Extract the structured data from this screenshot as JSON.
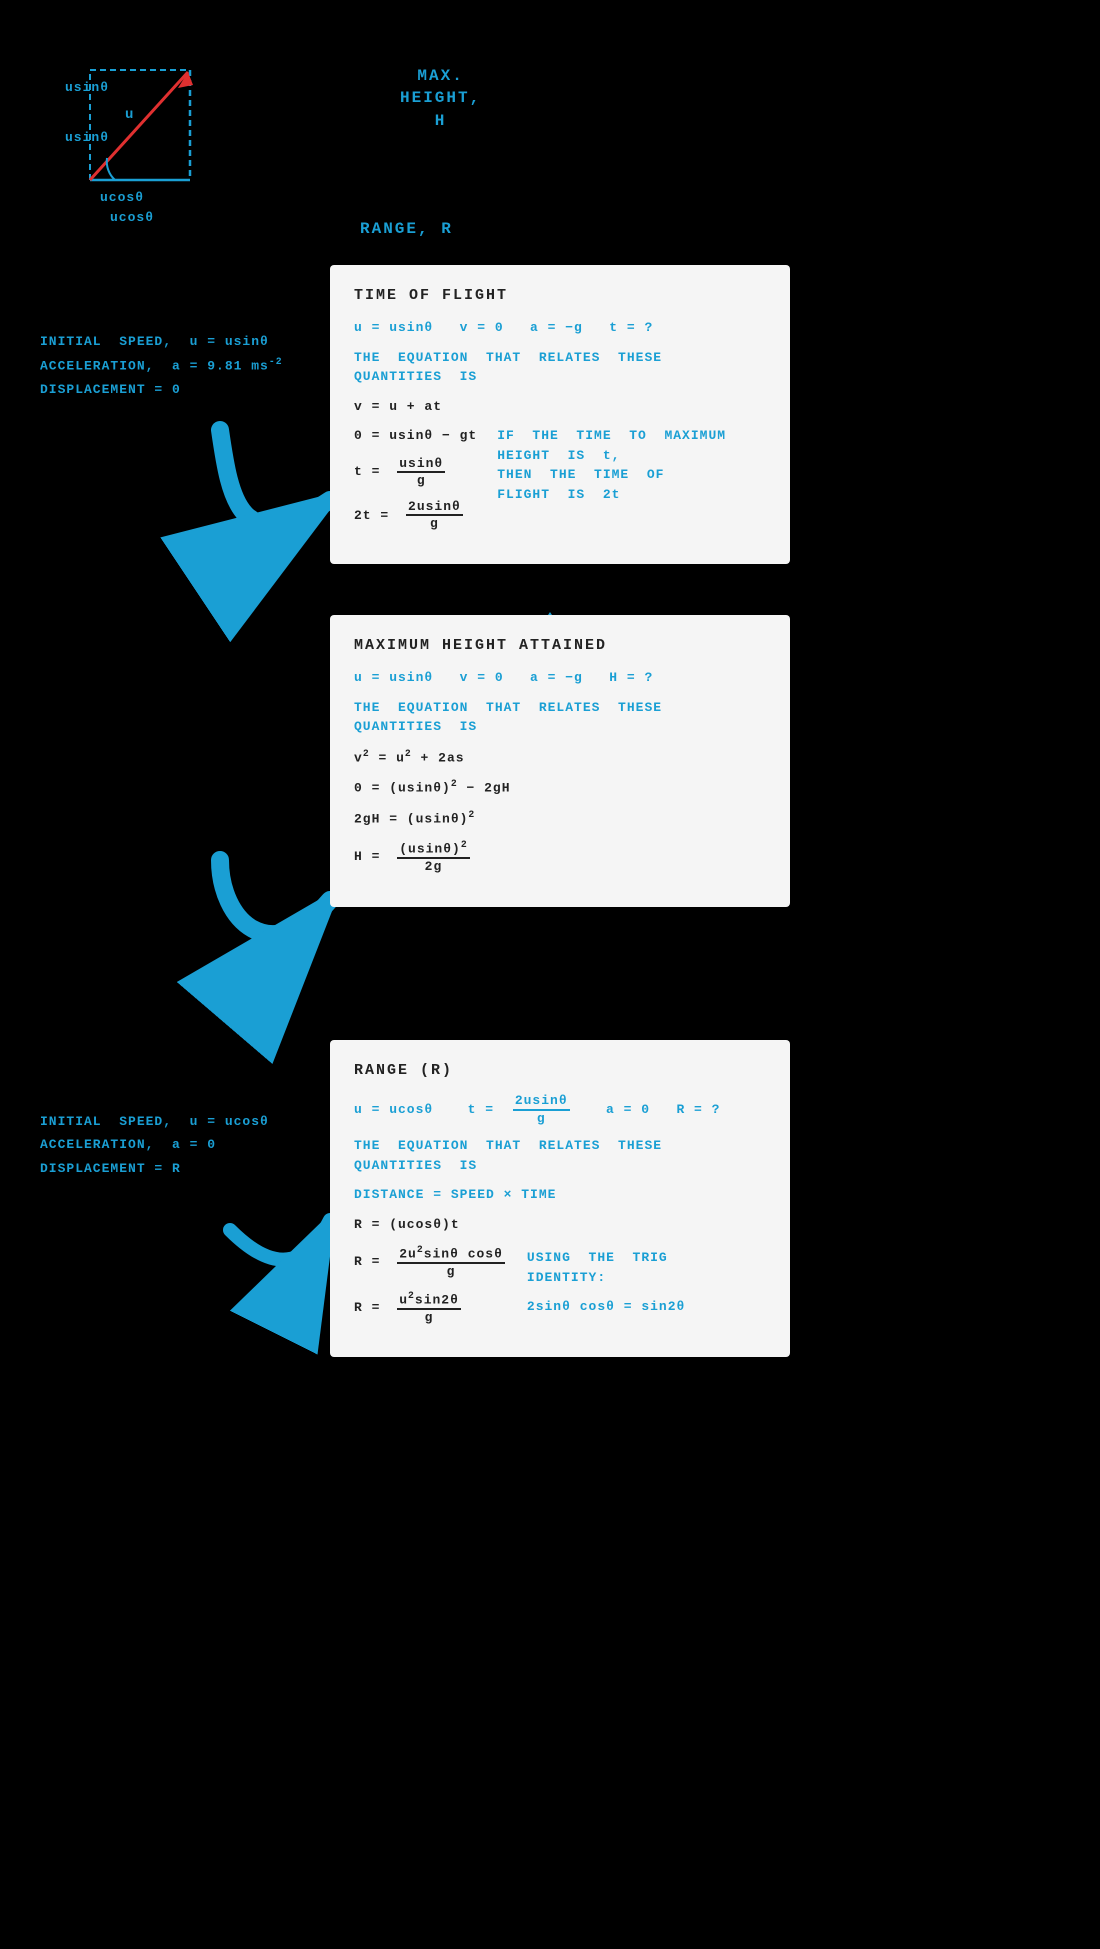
{
  "diagram": {
    "label_usin": "usinθ",
    "label_ucos": "ucosθ",
    "label_u": "u"
  },
  "labels": {
    "max_height": "MAX.",
    "height": "HEIGHT,",
    "h": "H",
    "range_top": "RANGE, R"
  },
  "left_info_top": {
    "line1": "INITIAL  SPEED,  u = usinθ",
    "line2": "ACCELERATION,  a = 9.81 ms⁻²",
    "line3": "DISPLACEMENT = 0"
  },
  "left_info_bottom": {
    "line1": "INITIAL  SPEED,  u = ucosθ",
    "line2": "ACCELERATION,  a = 0",
    "line3": "DISPLACEMENT = R"
  },
  "box_time": {
    "title": "TIME  OF  FLIGHT",
    "line1": "u = usinθ    v = 0    a = −g    t = ?",
    "eq_label": "THE  EQUATION  THAT  RELATES  THESE  QUANTITIES  IS",
    "eq1": "v = u + at",
    "eq2": "0 = usinθ − gt",
    "eq3_left": "t =",
    "eq3_num": "usinθ",
    "eq3_den": "g",
    "eq4_left": "2t =",
    "eq4_num": "2usinθ",
    "eq4_den": "g",
    "note": "IF  THE  TIME  TO  MAXIMUM  HEIGHT  IS  t,  THEN  THE  TIME  OF  FLIGHT  IS  2t"
  },
  "box_max": {
    "title": "MAXIMUM  HEIGHT  ATTAINED",
    "line1": "u = usinθ    v = 0    a = −g    H = ?",
    "eq_label": "THE  EQUATION  THAT  RELATES  THESE  QUANTITIES  IS",
    "eq1": "v² = u² + 2as",
    "eq2": "0 = (usinθ)² − 2gH",
    "eq3": "2gH = (usinθ)²",
    "eq4_left": "H =",
    "eq4_num": "(usinθ)²",
    "eq4_den": "2g"
  },
  "box_range": {
    "title": "RANGE  (R)",
    "line1_left": "u = ucosθ",
    "line1_t": "t =",
    "line1_t_num": "2usinθ",
    "line1_t_den": "g",
    "line1_right": "a = 0    R = ?",
    "eq_label": "THE  EQUATION  THAT  RELATES  THESE  QUANTITIES  IS",
    "eq1": "DISTANCE = SPEED × TIME",
    "eq2": "R = (ucosθ)t",
    "eq3_left": "R =",
    "eq3_num": "2u²sinθ cosθ",
    "eq3_den": "g",
    "note": "USING  THE  TRIG  IDENTITY:",
    "note2": "2sinθ cosθ = sin2θ",
    "eq4_left": "R =",
    "eq4_num": "u²sin2θ",
    "eq4_den": "g"
  }
}
